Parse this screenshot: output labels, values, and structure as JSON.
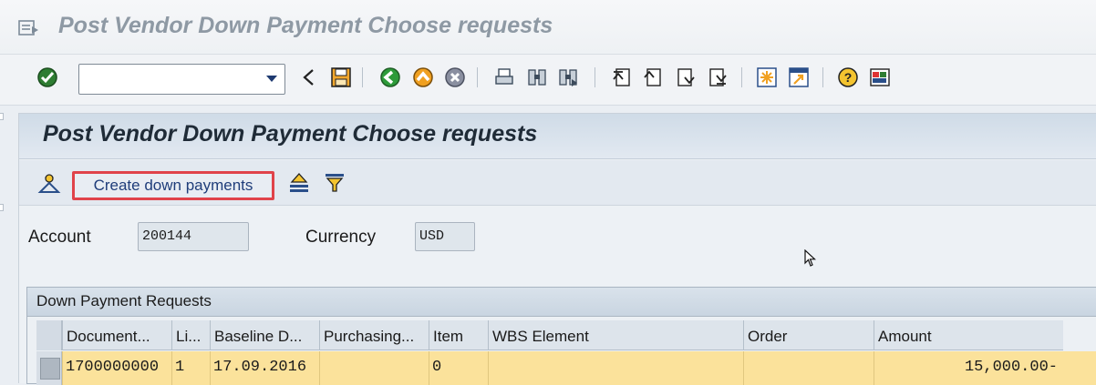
{
  "window": {
    "title": "Post Vendor Down Payment Choose requests",
    "icon": "menu-icon"
  },
  "system_toolbar": {
    "command_field_value": "",
    "buttons": [
      {
        "name": "enter-icon",
        "color": "#2e8b2e"
      },
      {
        "name": "back-arrow-icon"
      },
      {
        "name": "save-icon",
        "color": "#f2a72d"
      },
      {
        "name": "back-icon",
        "color": "#2d9b3a"
      },
      {
        "name": "exit-icon",
        "color": "#f0a020"
      },
      {
        "name": "cancel-icon",
        "color": "#8a8fa0"
      },
      {
        "name": "print-icon"
      },
      {
        "name": "find-icon"
      },
      {
        "name": "find-next-icon"
      },
      {
        "name": "first-page-icon"
      },
      {
        "name": "previous-page-icon"
      },
      {
        "name": "next-page-icon"
      },
      {
        "name": "last-page-icon"
      },
      {
        "name": "new-session-icon"
      },
      {
        "name": "shortcut-icon"
      },
      {
        "name": "help-icon"
      },
      {
        "name": "customize-layout-icon"
      }
    ]
  },
  "screen": {
    "title": "Post Vendor Down Payment Choose requests",
    "app_toolbar": {
      "create_button_label": "Create down payments",
      "highlight_color": "#e0434a"
    },
    "fields": {
      "account_label": "Account",
      "account_value": "200144",
      "currency_label": "Currency",
      "currency_value": "USD"
    },
    "requests_table": {
      "title": "Down Payment Requests",
      "columns": [
        "Document...",
        "Li...",
        "Baseline D...",
        "Purchasing...",
        "Item",
        "WBS Element",
        "Order",
        "Amount"
      ],
      "rows": [
        [
          "1700000000",
          "1",
          "17.09.2016",
          "",
          "0",
          "",
          "",
          "15,000.00-"
        ]
      ],
      "selected_row_color": "#fbe29b"
    }
  }
}
